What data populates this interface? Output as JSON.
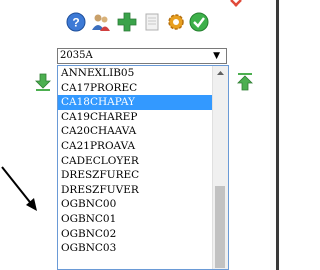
{
  "toolbar": {
    "icons": [
      "help-icon",
      "users-icon",
      "add-icon",
      "document-icon",
      "gear-icon",
      "check-icon"
    ]
  },
  "select": {
    "value": "2035A",
    "caret": "▼"
  },
  "list": {
    "items": [
      "ANNEXLIB05",
      "CA17PROREC",
      "CA18CHAPAY",
      "CA19CHAREP",
      "CA20CHAAVA",
      "CA21PROAVA",
      "CADECLOYER",
      "DRESZFUREC",
      "DRESZFUVER",
      "OGBNC00",
      "OGBNC01",
      "OGBNC02",
      "OGBNC03"
    ],
    "selected": "CA18CHAPAY"
  },
  "colors": {
    "selection": "#3399ff",
    "download": "#4caf50",
    "upload": "#4caf50",
    "list_border": "#6a9ad6"
  }
}
